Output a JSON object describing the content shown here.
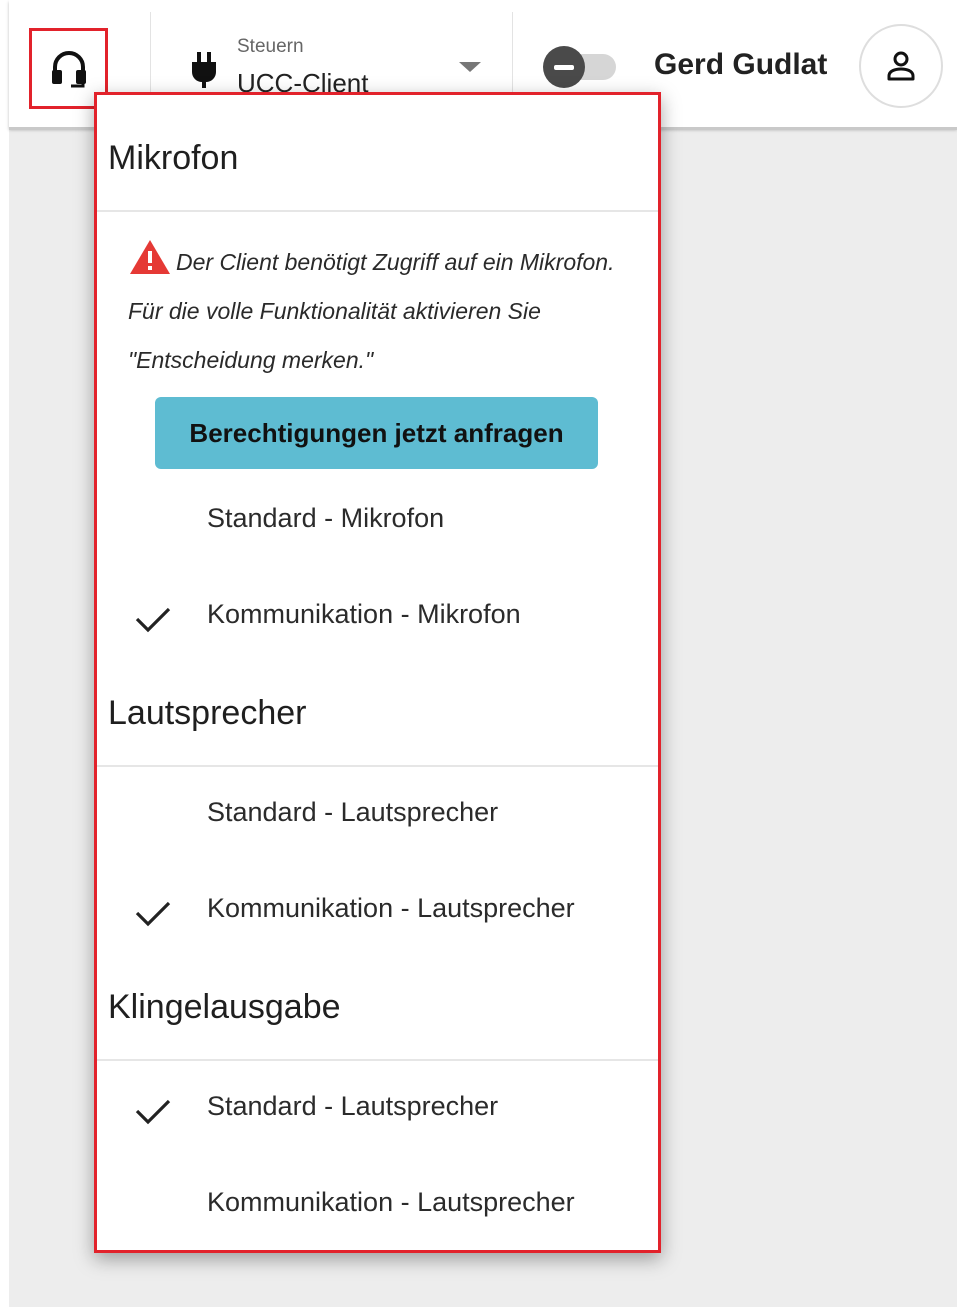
{
  "header": {
    "steuern_label": "Steuern",
    "steuern_value": "UCC-Client",
    "user_name": "Gerd Gudlat"
  },
  "popup": {
    "microphone": {
      "title": "Mikrofon",
      "warning_text": "Der Client benötigt Zugriff auf ein Mikrofon. Für die volle Funktionalität aktivieren Sie \"Entscheidung merken.\"",
      "permission_button": "Berechtigungen jetzt anfragen",
      "items": [
        {
          "label": "Standard - Mikrofon",
          "selected": false
        },
        {
          "label": "Kommunikation - Mikrofon",
          "selected": true
        }
      ]
    },
    "speaker": {
      "title": "Lautsprecher",
      "items": [
        {
          "label": "Standard - Lautsprecher",
          "selected": false
        },
        {
          "label": "Kommunikation - Lautsprecher",
          "selected": true
        }
      ]
    },
    "ringer": {
      "title": "Klingelausgabe",
      "items": [
        {
          "label": "Standard - Lautsprecher",
          "selected": true
        },
        {
          "label": "Kommunikation - Lautsprecher",
          "selected": false
        }
      ]
    }
  },
  "colors": {
    "highlight_border": "#e2222b",
    "button_bg": "#5ebcd2",
    "warning": "#e53935"
  },
  "icons": {
    "headset": "headset-icon",
    "plug": "plug-icon",
    "dropdown": "chevron-down-icon",
    "toggle": "dnd-toggle",
    "avatar": "person-icon",
    "warning": "warning-icon",
    "check": "check-icon"
  }
}
